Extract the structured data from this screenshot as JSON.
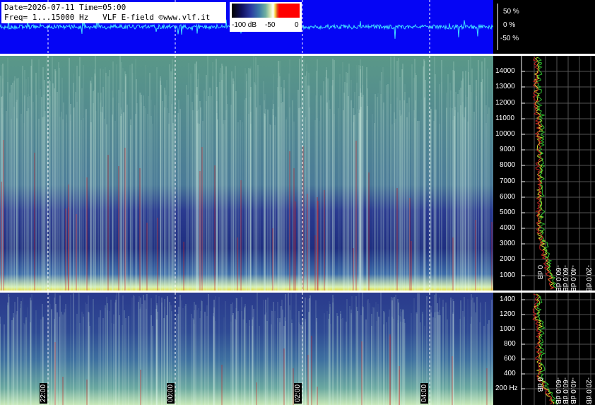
{
  "header": {
    "line1": "Date=2026-07-11 Time=05:00",
    "line2": "Freq= 1...15000 Hz   VLF E-field ©www.vlf.it"
  },
  "colorbar": {
    "labels": [
      "-100 dB",
      "-50",
      "0"
    ]
  },
  "waveform": {
    "percent_labels": [
      "50 %",
      "0 %",
      "-50 %"
    ]
  },
  "spectrogram_main": {
    "freq_labels": [
      "14000",
      "13000",
      "12000",
      "11000",
      "10000",
      "9000",
      "8000",
      "7000",
      "6000",
      "5000",
      "4000",
      "3000",
      "2000",
      "1000"
    ],
    "db_labels": [
      "0 dB",
      "-60.0 dB",
      "-60.0 dB",
      "-40.0 dB",
      "-20.0 dB"
    ]
  },
  "spectrogram_zoom": {
    "freq_labels": [
      "1400",
      "1200",
      "1000",
      "800",
      "600",
      "400",
      "200 Hz"
    ],
    "db_labels": [
      "0 dB",
      "-60.0 dB",
      "-60.0 dB",
      "-40.0 dB",
      "-20.0 dB"
    ]
  },
  "time_labels": [
    "22:00",
    "00:00",
    "02:00",
    "04:00"
  ],
  "colors": {
    "wave_bg": "#0505f5",
    "wave_line": "#40e0ff",
    "spectrum_yellow": "#e0e030",
    "spectrum_green": "#30c030",
    "spectrum_red": "#c02020"
  },
  "chart_data": [
    {
      "type": "heatmap",
      "title": "Date=2026-07-11 Time=05:00",
      "x_ticks": [
        "22:00",
        "00:00",
        "02:00",
        "04:00"
      ],
      "y_ticks": [
        1000,
        2000,
        3000,
        4000,
        5000,
        6000,
        7000,
        8000,
        9000,
        10000,
        11000,
        12000,
        13000,
        14000
      ],
      "ylim": [
        0,
        15000
      ],
      "colorbar": {
        "min": -100,
        "max": 0,
        "ticks": [
          -100,
          -50,
          0
        ],
        "unit": "dB"
      },
      "grid": true
    },
    {
      "type": "heatmap",
      "x_ticks": [
        "22:00",
        "00:00",
        "02:00",
        "04:00"
      ],
      "y_ticks": [
        200,
        400,
        600,
        800,
        1000,
        1200,
        1400
      ],
      "ylim": [
        100,
        1500
      ],
      "grid": true
    },
    {
      "type": "line",
      "ylim": [
        -60,
        60
      ],
      "y_ticks": [
        "50 %",
        "0 %",
        "-50 %"
      ]
    }
  ]
}
